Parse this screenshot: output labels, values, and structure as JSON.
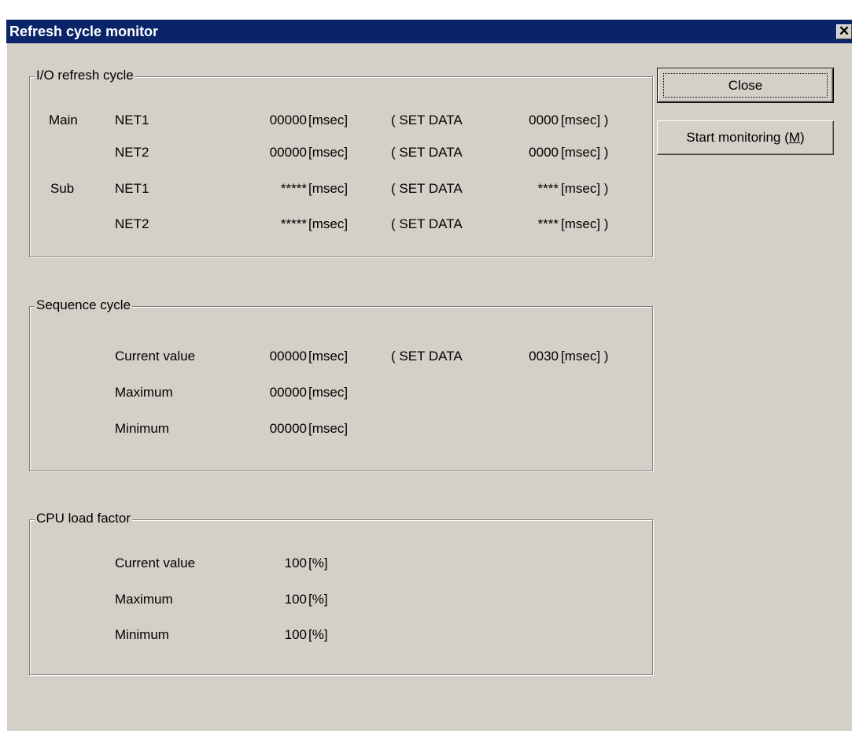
{
  "window": {
    "title": "Refresh cycle monitor",
    "close_glyph": "✕"
  },
  "buttons": {
    "close_label": "Close",
    "start_label_prefix": "Start monitoring (",
    "start_label_mnemonic": "M",
    "start_label_suffix": ")"
  },
  "io_refresh": {
    "legend": "I/O refresh cycle",
    "rows": [
      {
        "group": "Main",
        "net": "NET1",
        "value": "00000",
        "unit": "[msec]",
        "set_open": "( SET DATA",
        "set_value": "0000",
        "set_close": "[msec] )"
      },
      {
        "group": "",
        "net": "NET2",
        "value": "00000",
        "unit": "[msec]",
        "set_open": "( SET DATA",
        "set_value": "0000",
        "set_close": "[msec] )"
      },
      {
        "group": "Sub",
        "net": "NET1",
        "value": "*****",
        "unit": "[msec]",
        "set_open": "( SET DATA",
        "set_value": "****",
        "set_close": "[msec] )"
      },
      {
        "group": "",
        "net": "NET2",
        "value": "*****",
        "unit": "[msec]",
        "set_open": "( SET DATA",
        "set_value": "****",
        "set_close": "[msec] )"
      }
    ]
  },
  "sequence": {
    "legend": "Sequence cycle",
    "rows": [
      {
        "label": "Current value",
        "value": "00000",
        "unit": "[msec]",
        "set_open": "( SET DATA",
        "set_value": "0030",
        "set_close": "[msec] )"
      },
      {
        "label": "Maximum",
        "value": "00000",
        "unit": "[msec]"
      },
      {
        "label": "Minimum",
        "value": "00000",
        "unit": "[msec]"
      }
    ]
  },
  "cpu_load": {
    "legend": "CPU load factor",
    "rows": [
      {
        "label": "Current value",
        "value": "100",
        "unit": "[%]"
      },
      {
        "label": "Maximum",
        "value": "100",
        "unit": "[%]"
      },
      {
        "label": "Minimum",
        "value": "100",
        "unit": "[%]"
      }
    ]
  }
}
